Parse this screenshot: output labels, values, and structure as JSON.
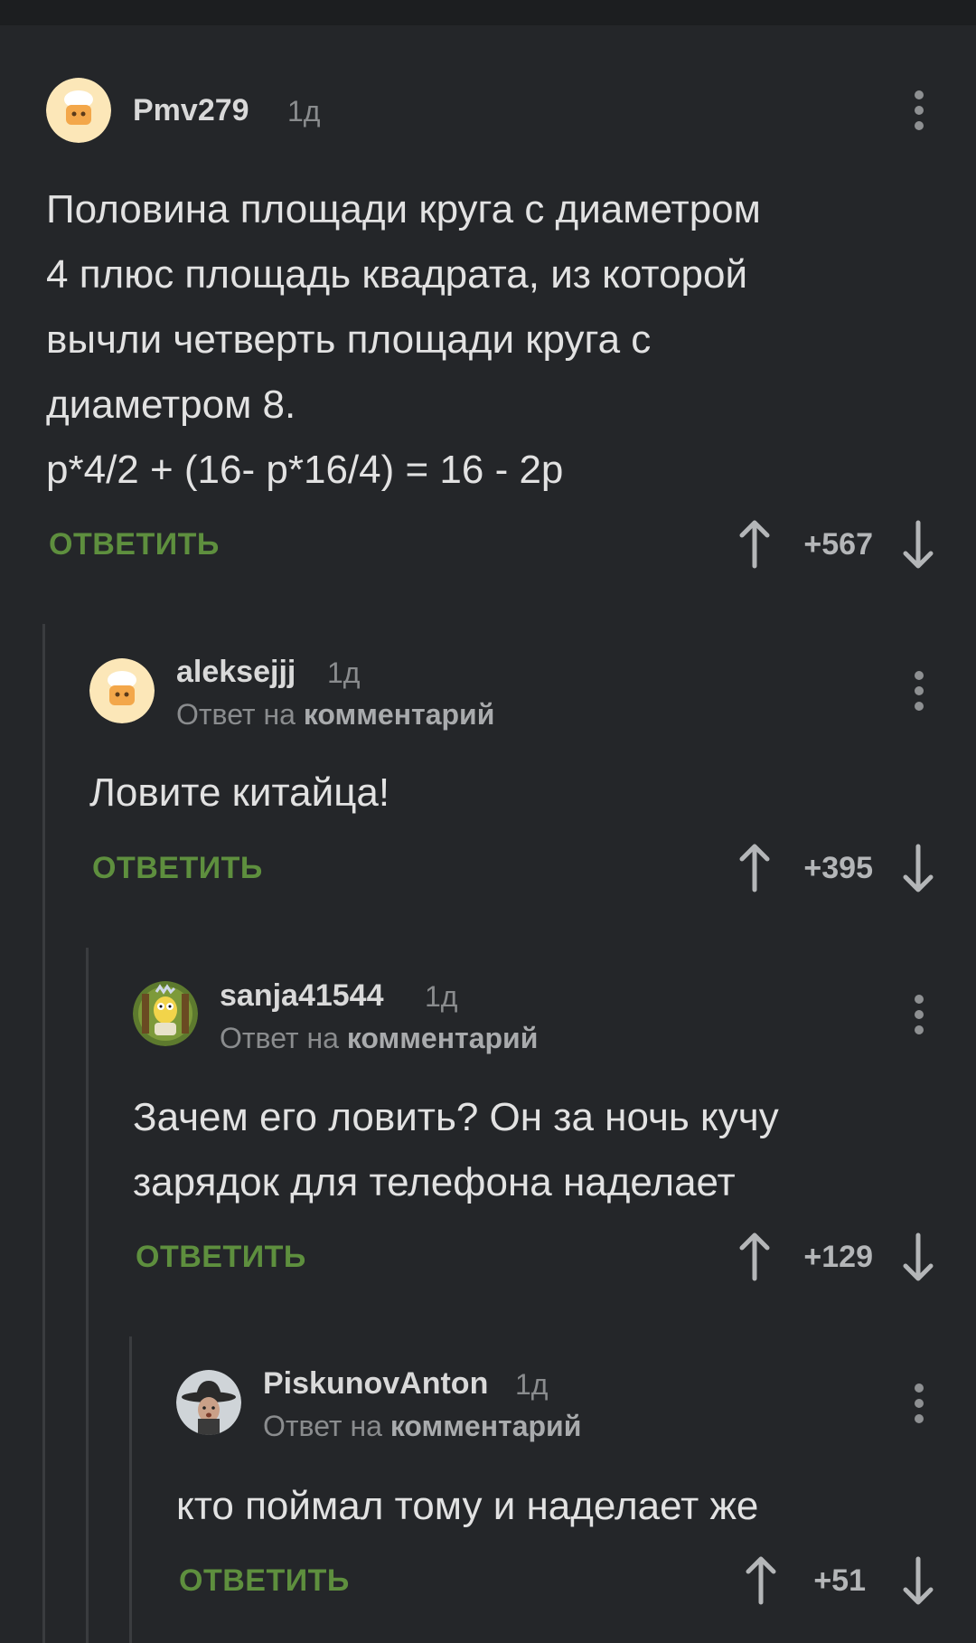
{
  "reply_meta_prefix": "Ответ на",
  "reply_meta_link": "комментарий",
  "reply_label": "ОТВЕТИТЬ",
  "comments": [
    {
      "username": "Pmv279",
      "time": "1д",
      "lines": [
        "Половина площади круга с диаметром",
        "4 плюс площадь квадрата, из которой",
        "вычли четверть площади круга с",
        "диаметром 8.",
        "p*4/2 + (16- p*16/4) = 16 - 2p"
      ],
      "score": "+567",
      "avatar": "chef-avatar"
    },
    {
      "username": "aleksejjj",
      "time": "1д",
      "lines": [
        "Ловите китайца!"
      ],
      "score": "+395",
      "avatar": "chef-avatar"
    },
    {
      "username": "sanja41544",
      "time": "1д",
      "lines": [
        "Зачем его ловить? Он за ночь кучу",
        "зарядок для телефона наделает"
      ],
      "score": "+129",
      "avatar": "cartoon-avatar"
    },
    {
      "username": "PiskunovAnton",
      "time": "1д",
      "lines": [
        "кто поймал тому и наделает же"
      ],
      "score": "+51",
      "avatar": "cowboy-photo-avatar"
    }
  ],
  "colors": {
    "background": "#242629",
    "accent_green": "#5e8f3e",
    "text": "#e2e2e2",
    "muted": "#8a8c8e"
  }
}
